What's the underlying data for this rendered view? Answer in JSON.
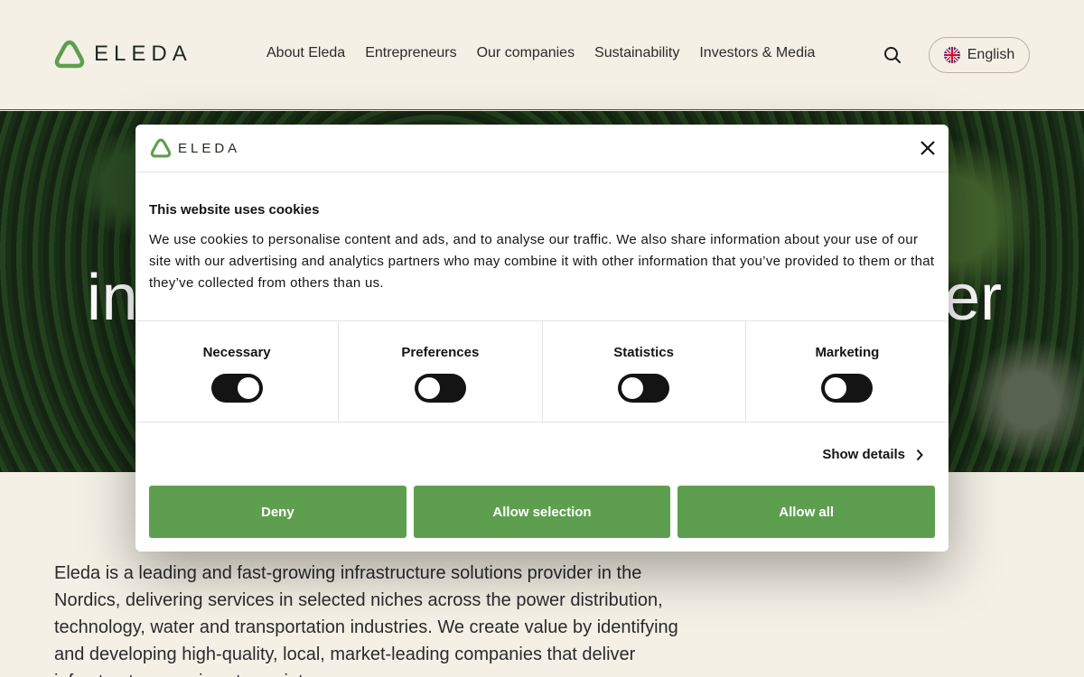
{
  "header": {
    "logo_text": "ELEDA",
    "nav": [
      "About Eleda",
      "Entrepreneurs",
      "Our companies",
      "Sustainability",
      "Investors & Media"
    ],
    "language": "English"
  },
  "hero": {
    "text_left": "in",
    "text_right": "er"
  },
  "intro": {
    "text": "Eleda is a leading and fast-growing infrastructure solutions provider in the Nordics, delivering services in selected niches across the power distribution, technology, water and transportation industries. We create value by identifying and developing high-quality, local, market-leading companies that deliver infrastructure services to society."
  },
  "cookie_modal": {
    "logo_text": "ELEDA",
    "title": "This website uses cookies",
    "text": "We use cookies to personalise content and ads, and to analyse our traffic. We also share information about your use of our site with our advertising and analytics partners who may combine it with other information that you’ve provided to them or that they’ve collected from others than us.",
    "categories": [
      {
        "label": "Necessary",
        "enabled": true
      },
      {
        "label": "Preferences",
        "enabled": false
      },
      {
        "label": "Statistics",
        "enabled": false
      },
      {
        "label": "Marketing",
        "enabled": false
      }
    ],
    "show_details": "Show details",
    "buttons": {
      "deny": "Deny",
      "allow_selection": "Allow selection",
      "allow_all": "Allow all"
    }
  },
  "colors": {
    "brand_green": "#5d9f4e",
    "background": "#f4f0e6",
    "toggle": "#141414"
  }
}
